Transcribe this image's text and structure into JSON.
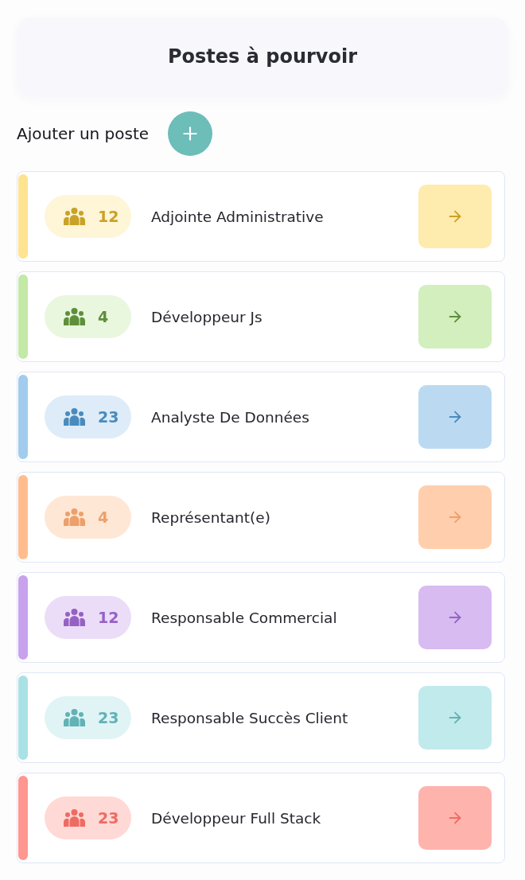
{
  "header": {
    "title": "Postes à pourvoir"
  },
  "add_position": {
    "label": "Ajouter un poste"
  },
  "positions": [
    {
      "title": "Adjointe Administrative",
      "count": "12",
      "color": "#c9a227"
    },
    {
      "title": "Développeur Js",
      "count": "4",
      "color": "#5e8f3a"
    },
    {
      "title": "Analyste De Données",
      "count": "23",
      "color": "#4a8bbd"
    },
    {
      "title": "Représentant(e)",
      "count": "4",
      "color": "#eda06a"
    },
    {
      "title": "Responsable Commercial",
      "count": "12",
      "color": "#9562c4"
    },
    {
      "title": "Responsable Succès Client",
      "count": "23",
      "color": "#62b2b6"
    },
    {
      "title": "Développeur Full Stack",
      "count": "23",
      "color": "#ef6b62"
    }
  ]
}
